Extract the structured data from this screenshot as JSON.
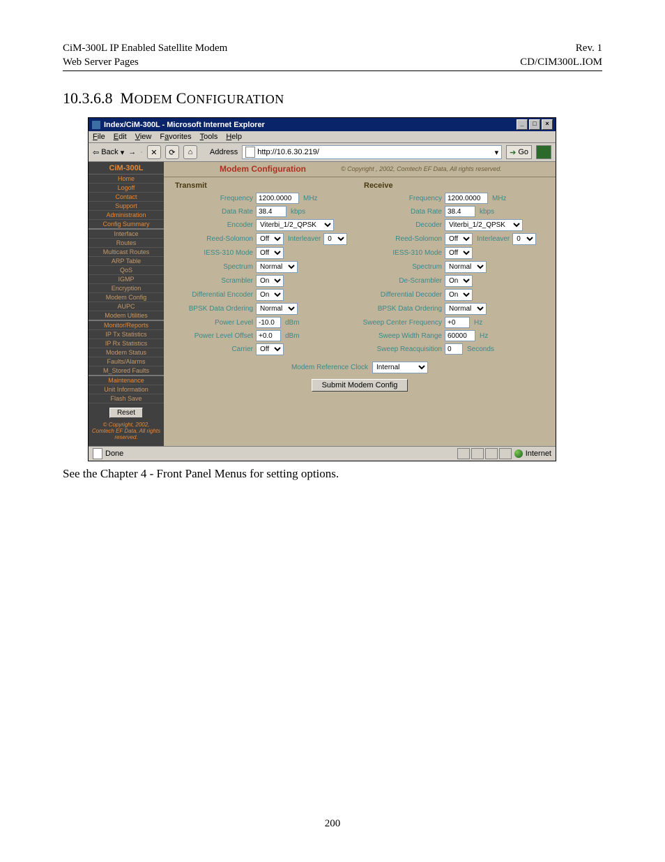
{
  "doc": {
    "header_left_1": "CiM-300L IP Enabled Satellite Modem",
    "header_left_2": "Web Server Pages",
    "header_right_1": "Rev. 1",
    "header_right_2": "CD/CIM300L.IOM",
    "section_number": "10.3.6.8",
    "section_title_1": "M",
    "section_title_rest_1": "ODEM ",
    "section_title_2": "C",
    "section_title_rest_2": "ONFIGURATION",
    "caption": "See the Chapter 4 - Front Panel Menus for setting options.",
    "page_number": "200"
  },
  "window": {
    "title": "Index/CiM-300L - Microsoft Internet Explorer",
    "btn_min": "_",
    "btn_max": "□",
    "btn_close": "×"
  },
  "menubar": {
    "file": "File",
    "edit": "Edit",
    "view": "View",
    "favorites": "Favorites",
    "tools": "Tools",
    "help": "Help"
  },
  "toolbar": {
    "back": "Back",
    "address_label": "Address",
    "address_value": "http://10.6.30.219/",
    "go": "Go"
  },
  "sidebar": {
    "brand": "CiM-300L",
    "items": [
      "Home",
      "Logoff",
      "Contact",
      "Support",
      "Administration",
      "Config Summary",
      "Interface",
      "Routes",
      "Multicast Routes",
      "ARP Table",
      "QoS",
      "IGMP",
      "Encryption",
      "Modem Config",
      "AUPC",
      "Modem Utilities",
      "Monitor/Reports",
      "IP Tx Statistics",
      "IP Rx Statistics",
      "Modem Status",
      "Faults/Alarms",
      "M_Stored Faults",
      "Maintenance",
      "Unit Information",
      "Flash Save"
    ],
    "reset": "Reset",
    "copyright": "© Copyright, 2002, Comtech EF Data, All rights reserved."
  },
  "page": {
    "title": "Modem Configuration",
    "copyright": "© Copyright , 2002, Comtech EF Data, All rights reserved.",
    "tx_header": "Transmit",
    "rx_header": "Receive",
    "tx": {
      "frequency_label": "Frequency",
      "frequency_value": "1200.0000",
      "frequency_unit": "MHz",
      "datarate_label": "Data Rate",
      "datarate_value": "38.4",
      "datarate_unit": "kbps",
      "encoder_label": "Encoder",
      "encoder_value": "Viterbi_1/2_QPSK",
      "rs_label": "Reed-Solomon",
      "rs_value": "Off",
      "interleaver_label": "Interleaver",
      "interleaver_value": "0",
      "iess_label": "IESS-310 Mode",
      "iess_value": "Off",
      "spectrum_label": "Spectrum",
      "spectrum_value": "Normal",
      "scrambler_label": "Scrambler",
      "scrambler_value": "On",
      "diff_label": "Differential Encoder",
      "diff_value": "On",
      "bpsk_label": "BPSK Data Ordering",
      "bpsk_value": "Normal",
      "power_label": "Power Level",
      "power_value": "-10.0",
      "power_unit": "dBm",
      "power_off_label": "Power Level Offset",
      "power_off_value": "+0.0",
      "power_off_unit": "dBm",
      "carrier_label": "Carrier",
      "carrier_value": "Off"
    },
    "rx": {
      "frequency_label": "Frequency",
      "frequency_value": "1200.0000",
      "frequency_unit": "MHz",
      "datarate_label": "Data Rate",
      "datarate_value": "38.4",
      "datarate_unit": "kbps",
      "decoder_label": "Decoder",
      "decoder_value": "Viterbi_1/2_QPSK",
      "rs_label": "Reed-Solomon",
      "rs_value": "Off",
      "interleaver_label": "Interleaver",
      "interleaver_value": "0",
      "iess_label": "IESS-310 Mode",
      "iess_value": "Off",
      "spectrum_label": "Spectrum",
      "spectrum_value": "Normal",
      "descrambler_label": "De-Scrambler",
      "descrambler_value": "On",
      "diff_label": "Differential Decoder",
      "diff_value": "On",
      "bpsk_label": "BPSK Data Ordering",
      "bpsk_value": "Normal",
      "sweepcf_label": "Sweep Center Frequency",
      "sweepcf_value": "+0",
      "sweepcf_unit": "Hz",
      "sweepwr_label": "Sweep Width Range",
      "sweepwr_value": "60000",
      "sweepwr_unit": "Hz",
      "sweepre_label": "Sweep Reacquisition",
      "sweepre_value": "0",
      "sweepre_unit": "Seconds"
    },
    "refclock_label": "Modem Reference Clock",
    "refclock_value": "Internal",
    "submit": "Submit Modem Config"
  },
  "statusbar": {
    "status": "Done",
    "zone": "Internet"
  }
}
